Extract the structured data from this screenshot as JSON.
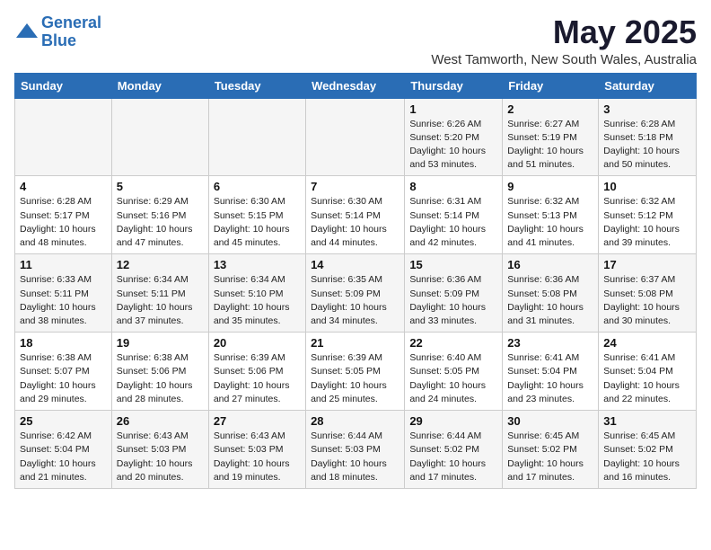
{
  "header": {
    "logo_line1": "General",
    "logo_line2": "Blue",
    "month": "May 2025",
    "subtitle": "West Tamworth, New South Wales, Australia"
  },
  "days_of_week": [
    "Sunday",
    "Monday",
    "Tuesday",
    "Wednesday",
    "Thursday",
    "Friday",
    "Saturday"
  ],
  "weeks": [
    [
      {
        "day": "",
        "info": ""
      },
      {
        "day": "",
        "info": ""
      },
      {
        "day": "",
        "info": ""
      },
      {
        "day": "",
        "info": ""
      },
      {
        "day": "1",
        "info": "Sunrise: 6:26 AM\nSunset: 5:20 PM\nDaylight: 10 hours\nand 53 minutes."
      },
      {
        "day": "2",
        "info": "Sunrise: 6:27 AM\nSunset: 5:19 PM\nDaylight: 10 hours\nand 51 minutes."
      },
      {
        "day": "3",
        "info": "Sunrise: 6:28 AM\nSunset: 5:18 PM\nDaylight: 10 hours\nand 50 minutes."
      }
    ],
    [
      {
        "day": "4",
        "info": "Sunrise: 6:28 AM\nSunset: 5:17 PM\nDaylight: 10 hours\nand 48 minutes."
      },
      {
        "day": "5",
        "info": "Sunrise: 6:29 AM\nSunset: 5:16 PM\nDaylight: 10 hours\nand 47 minutes."
      },
      {
        "day": "6",
        "info": "Sunrise: 6:30 AM\nSunset: 5:15 PM\nDaylight: 10 hours\nand 45 minutes."
      },
      {
        "day": "7",
        "info": "Sunrise: 6:30 AM\nSunset: 5:14 PM\nDaylight: 10 hours\nand 44 minutes."
      },
      {
        "day": "8",
        "info": "Sunrise: 6:31 AM\nSunset: 5:14 PM\nDaylight: 10 hours\nand 42 minutes."
      },
      {
        "day": "9",
        "info": "Sunrise: 6:32 AM\nSunset: 5:13 PM\nDaylight: 10 hours\nand 41 minutes."
      },
      {
        "day": "10",
        "info": "Sunrise: 6:32 AM\nSunset: 5:12 PM\nDaylight: 10 hours\nand 39 minutes."
      }
    ],
    [
      {
        "day": "11",
        "info": "Sunrise: 6:33 AM\nSunset: 5:11 PM\nDaylight: 10 hours\nand 38 minutes."
      },
      {
        "day": "12",
        "info": "Sunrise: 6:34 AM\nSunset: 5:11 PM\nDaylight: 10 hours\nand 37 minutes."
      },
      {
        "day": "13",
        "info": "Sunrise: 6:34 AM\nSunset: 5:10 PM\nDaylight: 10 hours\nand 35 minutes."
      },
      {
        "day": "14",
        "info": "Sunrise: 6:35 AM\nSunset: 5:09 PM\nDaylight: 10 hours\nand 34 minutes."
      },
      {
        "day": "15",
        "info": "Sunrise: 6:36 AM\nSunset: 5:09 PM\nDaylight: 10 hours\nand 33 minutes."
      },
      {
        "day": "16",
        "info": "Sunrise: 6:36 AM\nSunset: 5:08 PM\nDaylight: 10 hours\nand 31 minutes."
      },
      {
        "day": "17",
        "info": "Sunrise: 6:37 AM\nSunset: 5:08 PM\nDaylight: 10 hours\nand 30 minutes."
      }
    ],
    [
      {
        "day": "18",
        "info": "Sunrise: 6:38 AM\nSunset: 5:07 PM\nDaylight: 10 hours\nand 29 minutes."
      },
      {
        "day": "19",
        "info": "Sunrise: 6:38 AM\nSunset: 5:06 PM\nDaylight: 10 hours\nand 28 minutes."
      },
      {
        "day": "20",
        "info": "Sunrise: 6:39 AM\nSunset: 5:06 PM\nDaylight: 10 hours\nand 27 minutes."
      },
      {
        "day": "21",
        "info": "Sunrise: 6:39 AM\nSunset: 5:05 PM\nDaylight: 10 hours\nand 25 minutes."
      },
      {
        "day": "22",
        "info": "Sunrise: 6:40 AM\nSunset: 5:05 PM\nDaylight: 10 hours\nand 24 minutes."
      },
      {
        "day": "23",
        "info": "Sunrise: 6:41 AM\nSunset: 5:04 PM\nDaylight: 10 hours\nand 23 minutes."
      },
      {
        "day": "24",
        "info": "Sunrise: 6:41 AM\nSunset: 5:04 PM\nDaylight: 10 hours\nand 22 minutes."
      }
    ],
    [
      {
        "day": "25",
        "info": "Sunrise: 6:42 AM\nSunset: 5:04 PM\nDaylight: 10 hours\nand 21 minutes."
      },
      {
        "day": "26",
        "info": "Sunrise: 6:43 AM\nSunset: 5:03 PM\nDaylight: 10 hours\nand 20 minutes."
      },
      {
        "day": "27",
        "info": "Sunrise: 6:43 AM\nSunset: 5:03 PM\nDaylight: 10 hours\nand 19 minutes."
      },
      {
        "day": "28",
        "info": "Sunrise: 6:44 AM\nSunset: 5:03 PM\nDaylight: 10 hours\nand 18 minutes."
      },
      {
        "day": "29",
        "info": "Sunrise: 6:44 AM\nSunset: 5:02 PM\nDaylight: 10 hours\nand 17 minutes."
      },
      {
        "day": "30",
        "info": "Sunrise: 6:45 AM\nSunset: 5:02 PM\nDaylight: 10 hours\nand 17 minutes."
      },
      {
        "day": "31",
        "info": "Sunrise: 6:45 AM\nSunset: 5:02 PM\nDaylight: 10 hours\nand 16 minutes."
      }
    ]
  ]
}
